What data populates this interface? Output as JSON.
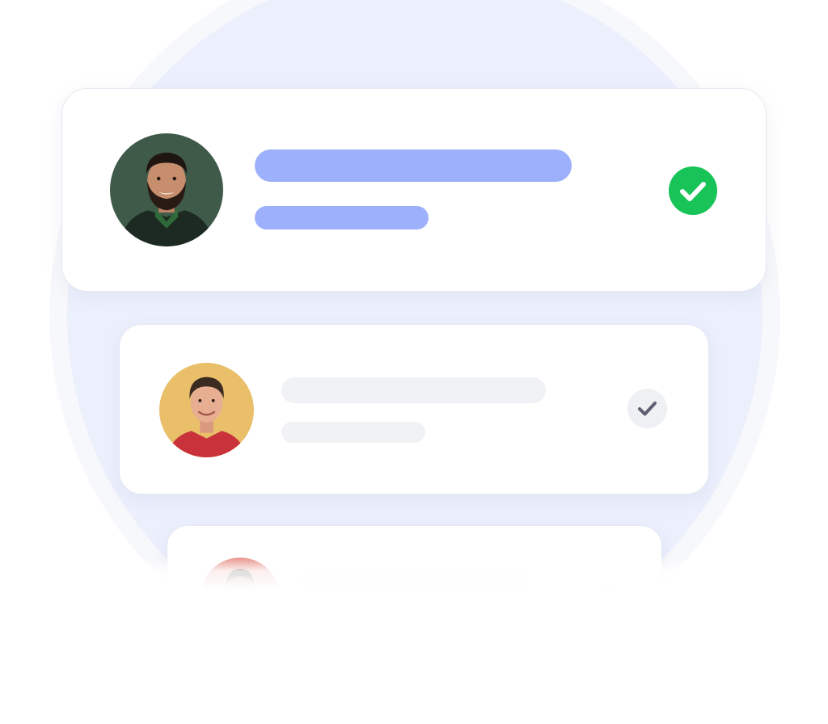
{
  "rows": [
    {
      "state": "selected",
      "avatar_bg": "#3f5a48",
      "check_color": "#18c358",
      "icon": "check-circle-icon"
    },
    {
      "state": "unselected",
      "avatar_bg": "#e9bf6a",
      "check_color": "#eff0f3",
      "icon": "check-icon"
    },
    {
      "state": "unselected",
      "avatar_bg": "#e8938c",
      "check_color": "#eff0f3",
      "icon": "check-icon"
    }
  ],
  "colors": {
    "accent": "#9db0fb",
    "background_circle": "#ecf0fd",
    "placeholder": "#f1f2f5",
    "success": "#18c358"
  }
}
